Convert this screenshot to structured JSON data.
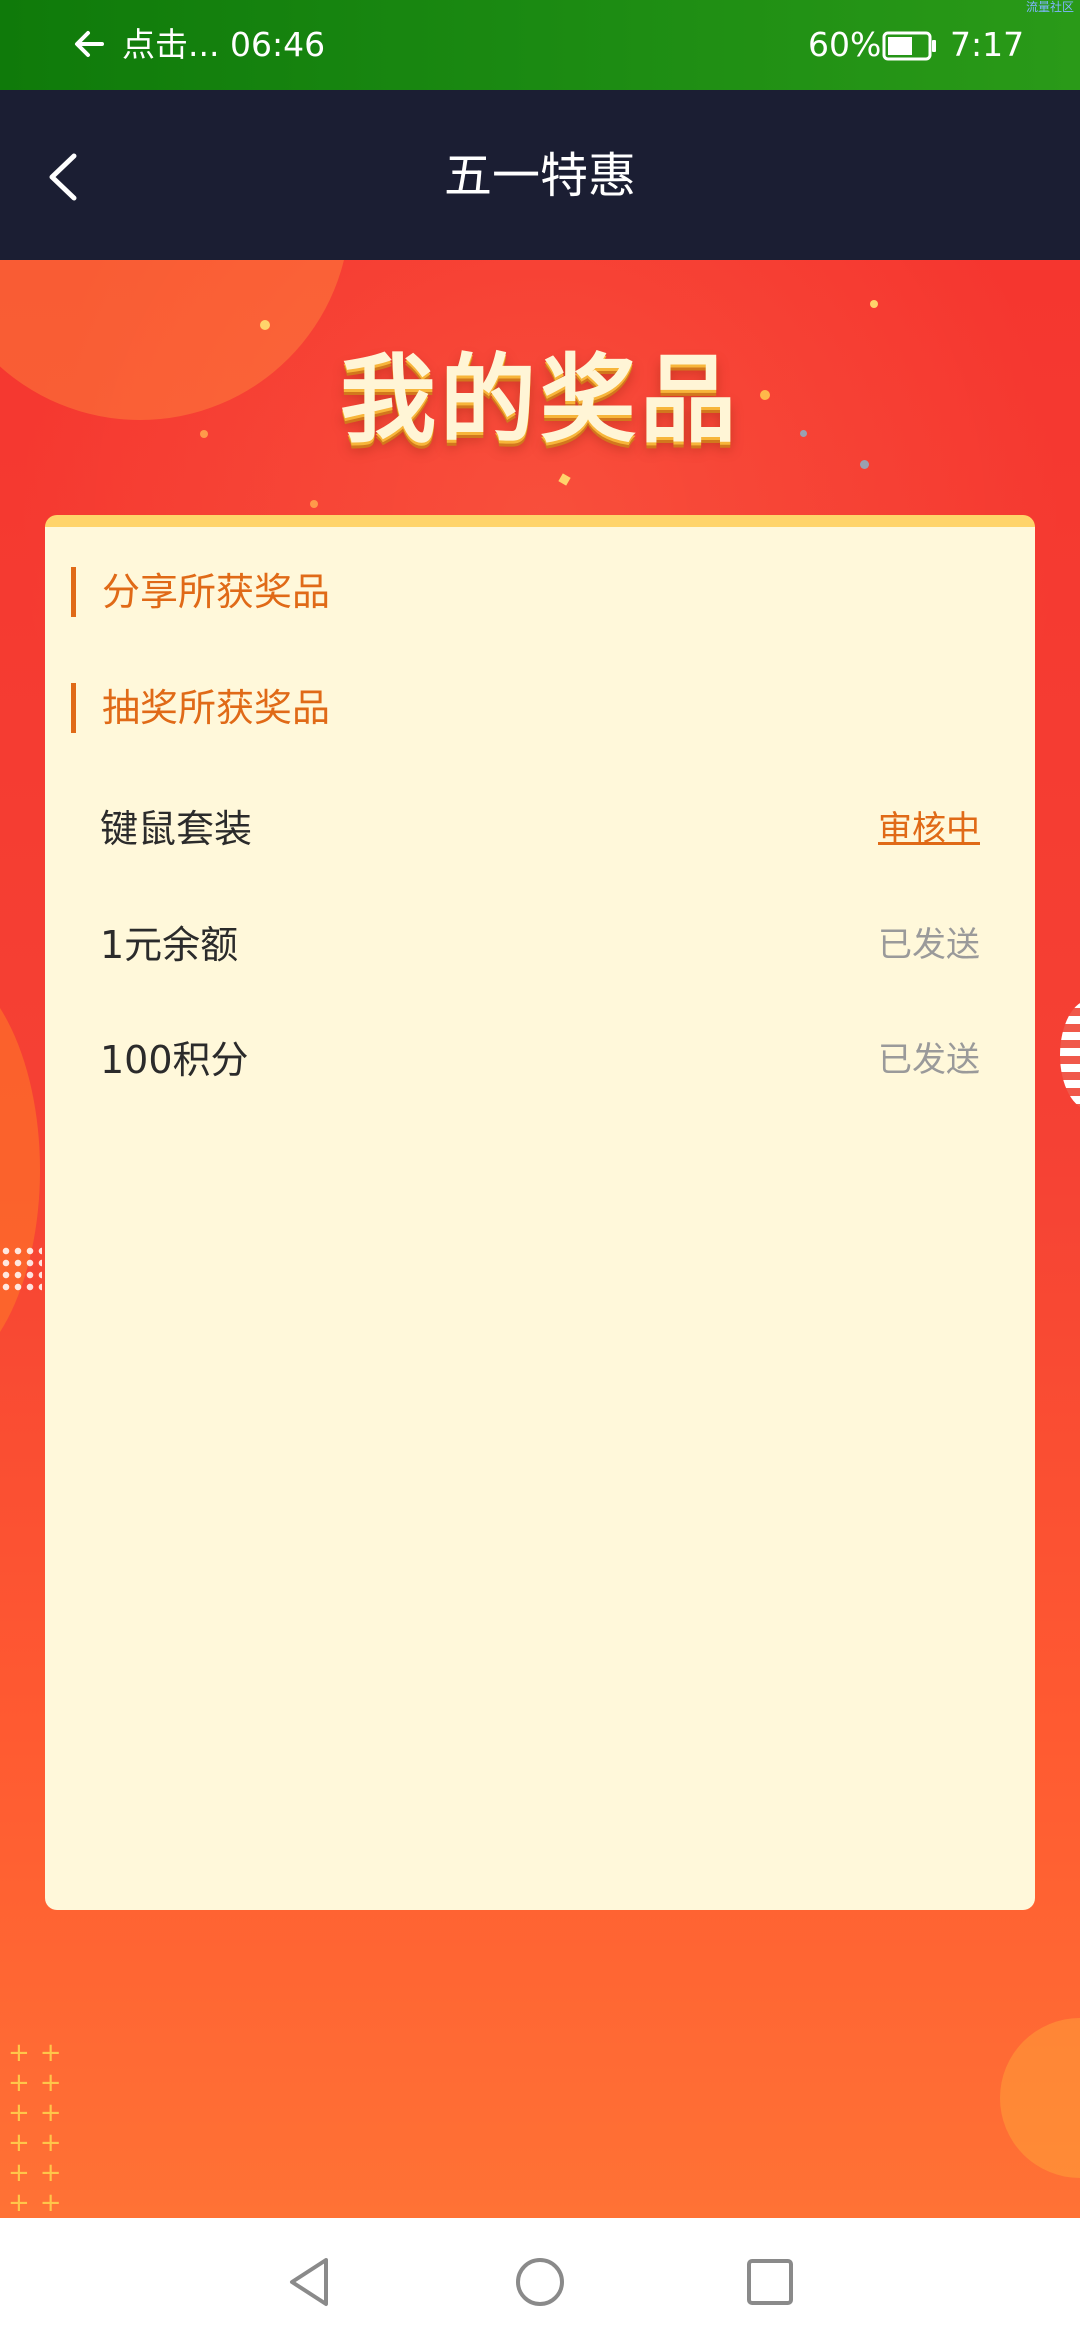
{
  "status_bar": {
    "notification_text": "点击...",
    "notification_time": "06:46",
    "battery_percent": "60%",
    "clock": "7:17",
    "corner_mark": "流量社区",
    "background": "#1b8a12"
  },
  "app_bar": {
    "title": "五一特惠",
    "background": "#1b1e33"
  },
  "hero": {
    "heading": "我的奖品"
  },
  "card": {
    "sections": [
      {
        "title": "分享所获奖品"
      },
      {
        "title": "抽奖所获奖品"
      }
    ],
    "prizes": [
      {
        "name": "键鼠套装",
        "status": "审核中",
        "status_color": "#e06a17"
      },
      {
        "name": "1元余额",
        "status": "已发送",
        "status_color": "#9a9a9a"
      },
      {
        "name": "100积分",
        "status": "已发送",
        "status_color": "#9a9a9a"
      }
    ],
    "accent": "#e06a17"
  },
  "nav_bar": {
    "buttons": [
      "back-triangle-icon",
      "home-circle-icon",
      "recents-square-icon"
    ]
  }
}
